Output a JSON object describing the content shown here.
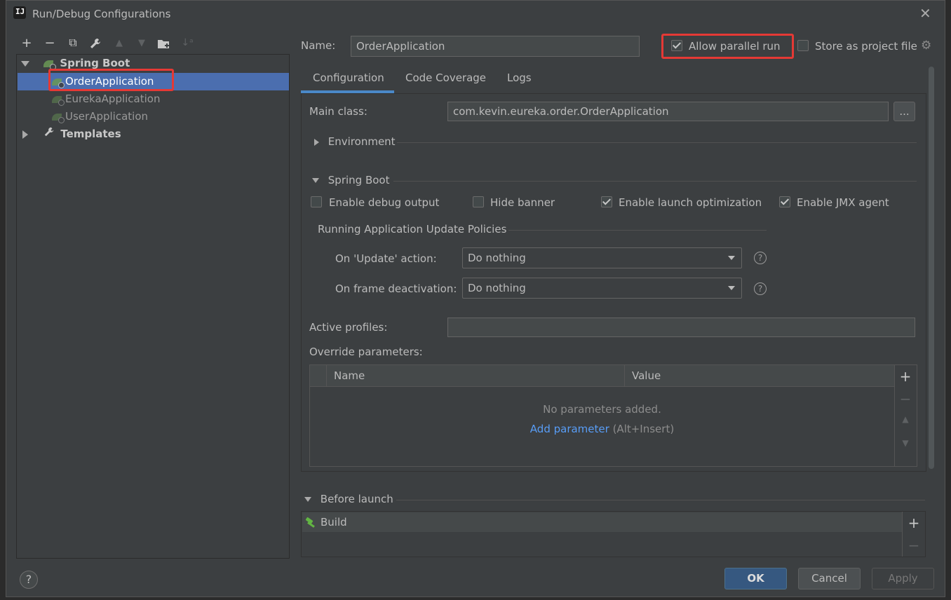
{
  "window": {
    "title": "Run/Debug Configurations",
    "close_glyph": "✕"
  },
  "toolbar": {
    "add": "+",
    "remove": "−",
    "copy": "⧉",
    "edit_defaults": "🔧",
    "move_up": "▲",
    "move_down": "▼",
    "new_folder": "📁",
    "sort": "↓ᵃ"
  },
  "tree": {
    "group_spring_boot": "Spring Boot",
    "items": [
      {
        "label": "OrderApplication",
        "selected": true
      },
      {
        "label": "EurekaApplication",
        "selected": false
      },
      {
        "label": "UserApplication",
        "selected": false
      }
    ],
    "templates": "Templates"
  },
  "header": {
    "name_label": "Name:",
    "name_value": "OrderApplication",
    "allow_parallel_label": "Allow parallel run",
    "allow_parallel_checked": true,
    "store_project_label": "Store as project file",
    "store_project_checked": false
  },
  "tabs": [
    {
      "label": "Configuration",
      "active": true
    },
    {
      "label": "Code Coverage",
      "active": false
    },
    {
      "label": "Logs",
      "active": false
    }
  ],
  "config": {
    "main_class_label": "Main class:",
    "main_class_value": "com.kevin.eureka.order.OrderApplication",
    "browse_label": "...",
    "environment_label": "Environment",
    "spring_boot_label": "Spring Boot",
    "options": [
      {
        "label": "Enable debug output",
        "checked": false
      },
      {
        "label": "Hide banner",
        "checked": false
      },
      {
        "label": "Enable launch optimization",
        "checked": true
      },
      {
        "label": "Enable JMX agent",
        "checked": true
      }
    ],
    "update_policies_label": "Running Application Update Policies",
    "on_update_label": "On 'Update' action:",
    "on_update_value": "Do nothing",
    "on_frame_label": "On frame deactivation:",
    "on_frame_value": "Do nothing",
    "active_profiles_label": "Active profiles:",
    "active_profiles_value": "",
    "override_label": "Override parameters:",
    "table": {
      "columns": [
        "Name",
        "Value"
      ],
      "empty_text": "No parameters added.",
      "add_link": "Add parameter",
      "add_hint": "(Alt+Insert)"
    }
  },
  "before_launch": {
    "label": "Before launch",
    "items": [
      "Build"
    ]
  },
  "footer": {
    "help": "?",
    "ok": "OK",
    "cancel": "Cancel",
    "apply": "Apply"
  },
  "colors": {
    "background": "#3c3f41",
    "selection": "#4b6eaf",
    "accent_tab": "#4a88c7",
    "link": "#589df6",
    "highlight_box": "#e53935",
    "primary_button": "#365880"
  }
}
